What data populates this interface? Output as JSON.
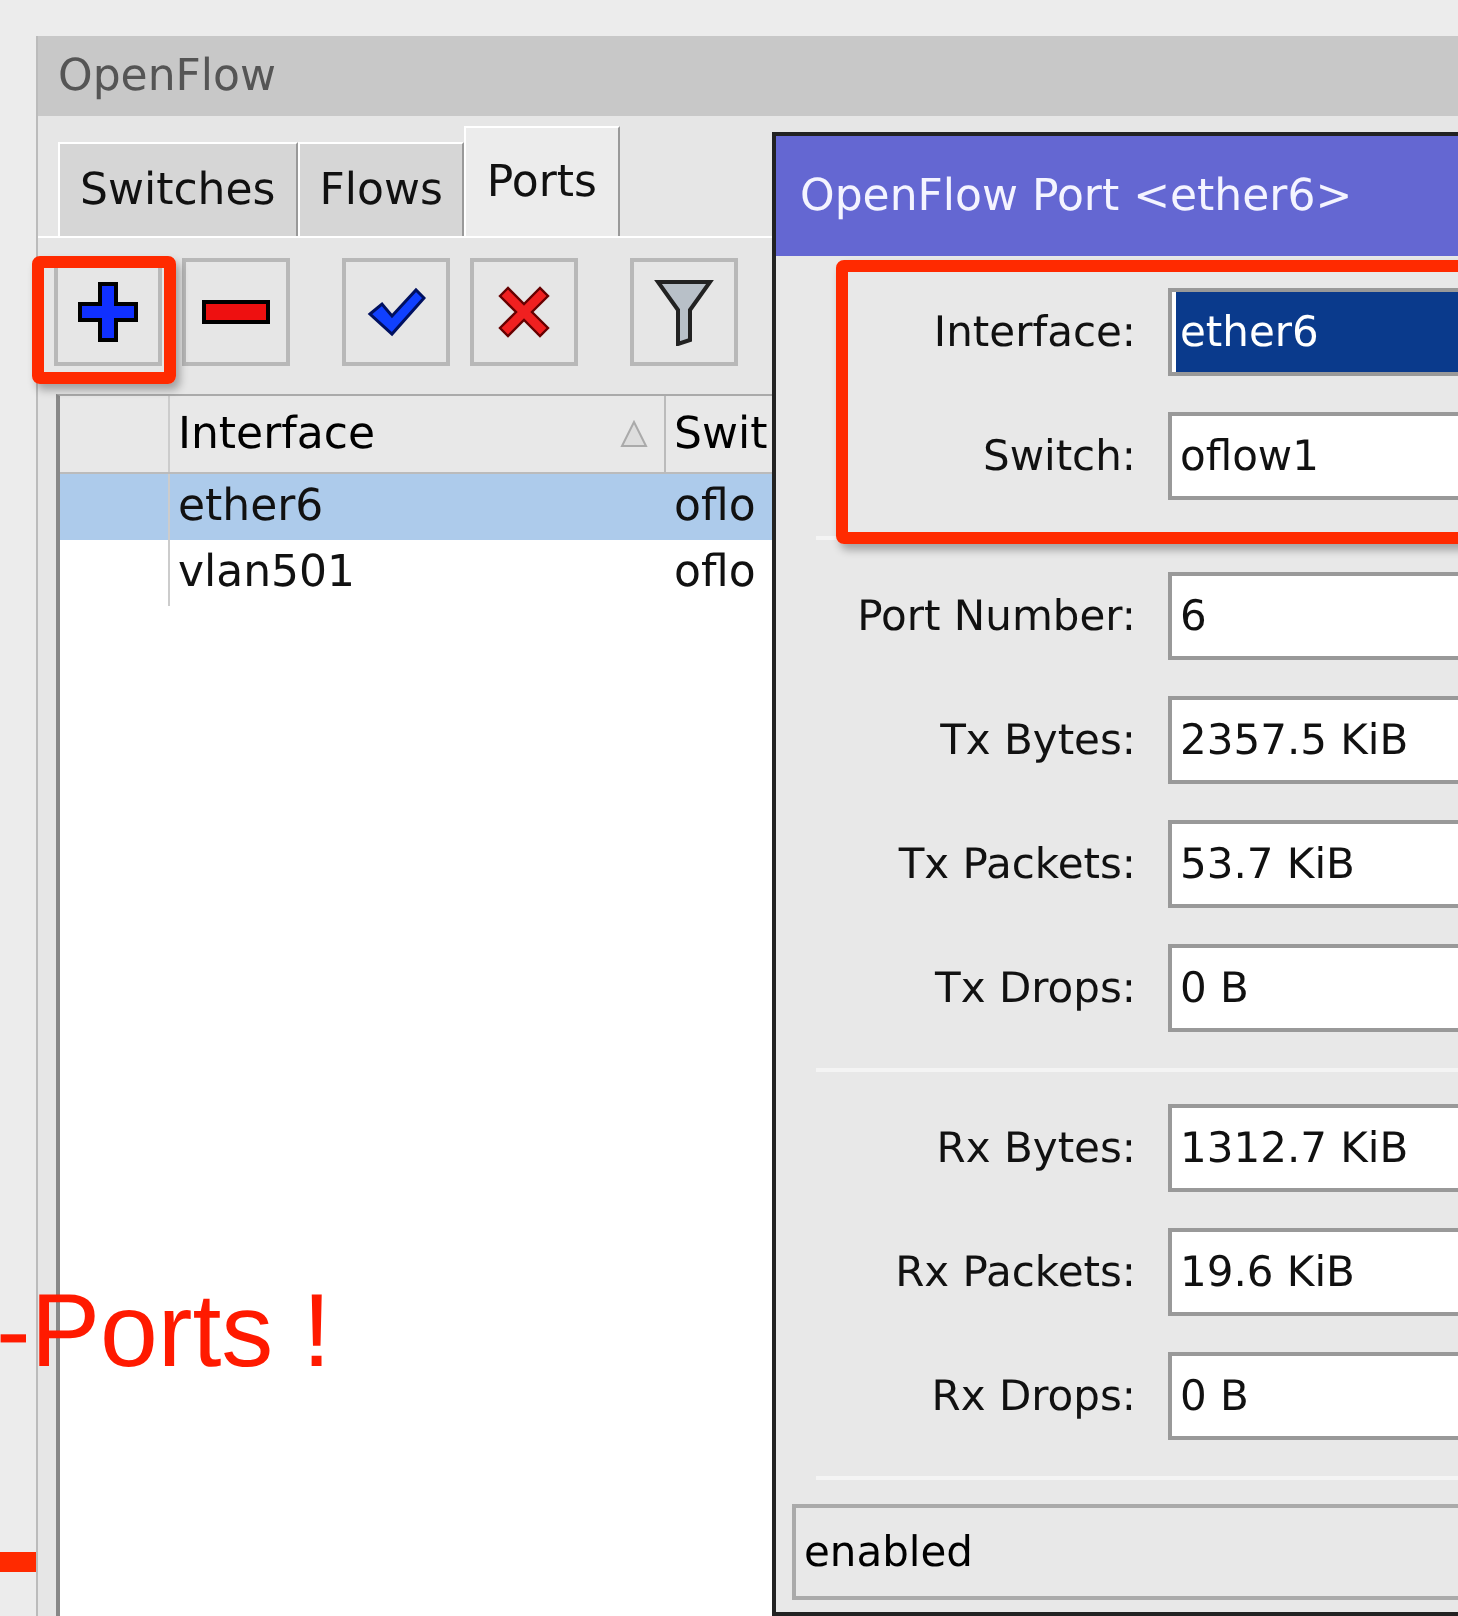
{
  "main_window": {
    "title": "OpenFlow",
    "tabs": [
      {
        "label": "Switches",
        "selected": false
      },
      {
        "label": "Flows",
        "selected": false
      },
      {
        "label": "Ports",
        "selected": true
      }
    ],
    "toolbar": [
      {
        "kind": "add",
        "highlighted": true
      },
      {
        "kind": "remove",
        "highlighted": false
      },
      {
        "kind": "enable",
        "highlighted": false
      },
      {
        "kind": "disable",
        "highlighted": false
      },
      {
        "kind": "filter",
        "highlighted": false
      }
    ],
    "table": {
      "columns": [
        {
          "label": "Interface",
          "sorted": true
        },
        {
          "label": "Swit"
        }
      ],
      "rows": [
        {
          "selected": true,
          "cells": [
            "ether6",
            "oflo"
          ]
        },
        {
          "selected": false,
          "cells": [
            "vlan501",
            "oflo"
          ]
        }
      ]
    }
  },
  "dialog": {
    "title": "OpenFlow Port <ether6>",
    "sections": [
      {
        "highlighted": true,
        "fields": [
          {
            "label": "Interface:",
            "value": "ether6",
            "selected": true
          },
          {
            "label": "Switch:",
            "value": "oflow1",
            "selected": false
          }
        ]
      },
      {
        "highlighted": false,
        "fields": [
          {
            "label": "Port Number:",
            "value": "6",
            "selected": false
          },
          {
            "label": "Tx Bytes:",
            "value": "2357.5 KiB",
            "selected": false
          },
          {
            "label": "Tx Packets:",
            "value": "53.7 KiB",
            "selected": false
          },
          {
            "label": "Tx Drops:",
            "value": "0 B",
            "selected": false
          }
        ]
      },
      {
        "highlighted": false,
        "fields": [
          {
            "label": "Rx Bytes:",
            "value": "1312.7 KiB",
            "selected": false
          },
          {
            "label": "Rx Packets:",
            "value": "19.6 KiB",
            "selected": false
          },
          {
            "label": "Rx Drops:",
            "value": "0 B",
            "selected": false
          }
        ]
      }
    ],
    "status": "enabled"
  },
  "annotation": {
    "text": "-Ports !"
  }
}
